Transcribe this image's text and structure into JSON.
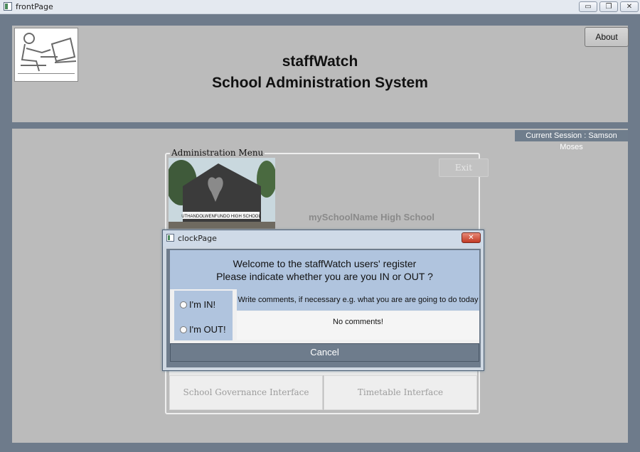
{
  "window": {
    "title": "frontPage",
    "controls": {
      "minimize": "▭",
      "maximize": "❐",
      "close": "✕"
    }
  },
  "header": {
    "title_line1": "staffWatch",
    "title_line2": "School Administration System",
    "about_label": "About"
  },
  "session": {
    "label": "Current Session : Samson Moses"
  },
  "admin_menu": {
    "legend": "Administration Menu",
    "exit_label": "Exit",
    "school_name": "mySchoolName High School",
    "school_sign": "UTHANDOLWENFUNDO HIGH SCHOOL",
    "buttons": {
      "governance": "School Governance Interface",
      "timetable": "Timetable Interface"
    }
  },
  "dialog": {
    "title": "clockPage",
    "close_glyph": "✕",
    "welcome_line1": "Welcome to the staffWatch users' register",
    "welcome_line2": "Please indicate whether you are you IN or OUT ?",
    "radio_in": "I'm IN!",
    "radio_out": "I'm OUT!",
    "comment_prompt": "Write comments, if necessary e.g. what you are are going to do today",
    "comment_value": "No comments!",
    "cancel_label": "Cancel"
  },
  "colors": {
    "frame": "#6e7b8b",
    "panel": "#bbbbbb",
    "dialog_accent": "#b0c4de",
    "dialog_close": "#c23a24"
  },
  "icons": [
    "app-icon",
    "minimize-icon",
    "maximize-icon",
    "close-icon",
    "logo-image",
    "school-photo"
  ]
}
